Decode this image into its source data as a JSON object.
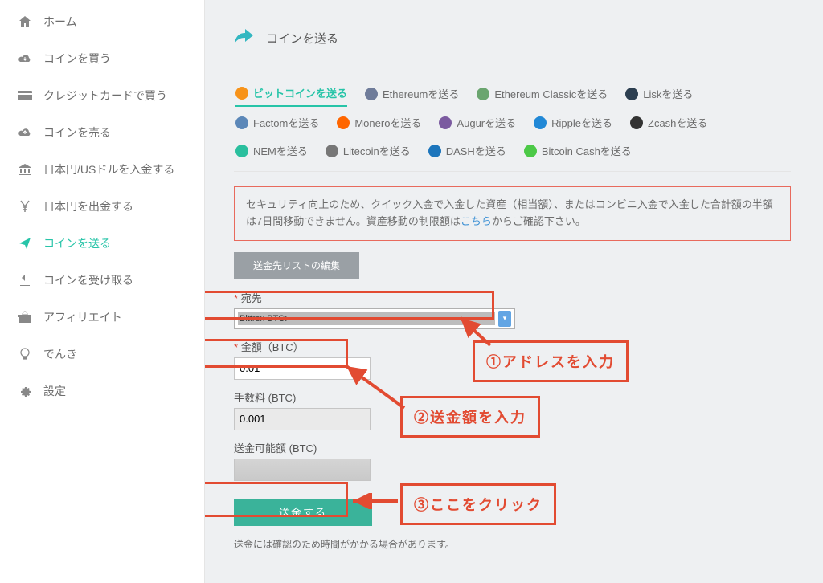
{
  "sidebar": {
    "items": [
      {
        "label": "ホーム",
        "icon": "home"
      },
      {
        "label": "コインを買う",
        "icon": "cloud-down"
      },
      {
        "label": "クレジットカードで買う",
        "icon": "card"
      },
      {
        "label": "コインを売る",
        "icon": "cloud-up"
      },
      {
        "label": "日本円/USドルを入金する",
        "icon": "bank"
      },
      {
        "label": "日本円を出金する",
        "icon": "yen"
      },
      {
        "label": "コインを送る",
        "icon": "send",
        "active": true
      },
      {
        "label": "コインを受け取る",
        "icon": "download"
      },
      {
        "label": "アフィリエイト",
        "icon": "gift"
      },
      {
        "label": "でんき",
        "icon": "bulb"
      },
      {
        "label": "設定",
        "icon": "gear"
      }
    ]
  },
  "page": {
    "title": "コインを送る"
  },
  "coin_tabs": [
    {
      "label": "ビットコインを送る",
      "color": "#f7931a",
      "active": true
    },
    {
      "label": "Ethereumを送る",
      "color": "#6f7c9a"
    },
    {
      "label": "Ethereum Classicを送る",
      "color": "#6aa56f"
    },
    {
      "label": "Liskを送る",
      "color": "#2c3e50"
    },
    {
      "label": "Factomを送る",
      "color": "#5b87b8"
    },
    {
      "label": "Moneroを送る",
      "color": "#ff6600"
    },
    {
      "label": "Augurを送る",
      "color": "#7b5aa0"
    },
    {
      "label": "Rippleを送る",
      "color": "#2188d6"
    },
    {
      "label": "Zcashを送る",
      "color": "#333"
    },
    {
      "label": "NEMを送る",
      "color": "#2abf9e"
    },
    {
      "label": "Litecoinを送る",
      "color": "#777"
    },
    {
      "label": "DASHを送る",
      "color": "#1c75bc"
    },
    {
      "label": "Bitcoin Cashを送る",
      "color": "#4cc947"
    }
  ],
  "notice": {
    "text_a": "セキュリティ向上のため、クイック入金で入金した資産（相当額）、またはコンビニ入金で入金した合計額の半額は7日間移動できません。資産移動の制限額は",
    "link": "こちら",
    "text_b": "からご確認下さい。"
  },
  "buttons": {
    "list_edit": "送金先リストの編集",
    "send": "送金する"
  },
  "form": {
    "dest_label": "宛先",
    "dest_value_prefix": "Bittrex BTC:",
    "amount_label": "金額（BTC）",
    "amount_value": "0.01",
    "fee_label": "手数料 (BTC)",
    "fee_value": "0.001",
    "available_label": "送金可能額 (BTC)"
  },
  "foot_note": "送金には確認のため時間がかかる場合があります。",
  "annotations": {
    "a1": "①アドレスを入力",
    "a2": "②送金額を入力",
    "a3": "③ここをクリック"
  },
  "icons": {
    "home": "⌂",
    "cloud-down": "☁",
    "card": "▭",
    "cloud-up": "☁",
    "bank": "🏛",
    "yen": "¥",
    "send": "✈",
    "download": "⬇",
    "gift": "🎁",
    "bulb": "💡",
    "gear": "⚙"
  }
}
